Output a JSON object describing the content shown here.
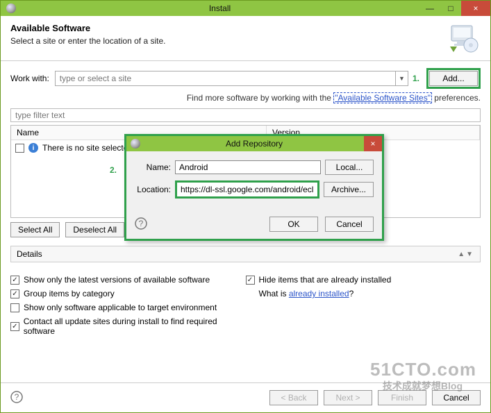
{
  "window": {
    "title": "Install",
    "minimize": "—",
    "maximize": "□",
    "close": "×"
  },
  "header": {
    "title": "Available Software",
    "subtitle": "Select a site or enter the location of a site."
  },
  "work_with": {
    "label": "Work with:",
    "placeholder": "type or select a site",
    "add_button": "Add...",
    "annotation_1": "1."
  },
  "find_line": {
    "prefix": "Find more software by working with the ",
    "link": "\"Available Software Sites\"",
    "suffix": " preferences."
  },
  "filter_placeholder": "type filter text",
  "table": {
    "col_name": "Name",
    "col_version": "Version",
    "no_site_msg": "There is no site selected.",
    "annotation_2": "2."
  },
  "select_all": "Select All",
  "deselect_all": "Deselect All",
  "details_label": "Details",
  "checks": {
    "latest": "Show only the latest versions of available software",
    "group": "Group items by category",
    "applicable": "Show only software applicable to target environment",
    "contact": "Contact all update sites during install to find required software",
    "hide_installed": "Hide items that are already installed",
    "what_is_prefix": "What is ",
    "what_is_link": "already installed",
    "what_is_suffix": "?"
  },
  "footer": {
    "back": "< Back",
    "next": "Next >",
    "finish": "Finish",
    "cancel": "Cancel"
  },
  "modal": {
    "title": "Add Repository",
    "close": "×",
    "name_label": "Name:",
    "name_value": "Android",
    "local_btn": "Local...",
    "loc_label": "Location:",
    "loc_value": "https://dl-ssl.google.com/android/eclipse/",
    "archive_btn": "Archive...",
    "ok": "OK",
    "cancel": "Cancel"
  },
  "watermark": {
    "w1": "51CTO.com",
    "w2": "技术成就梦想Blog"
  }
}
